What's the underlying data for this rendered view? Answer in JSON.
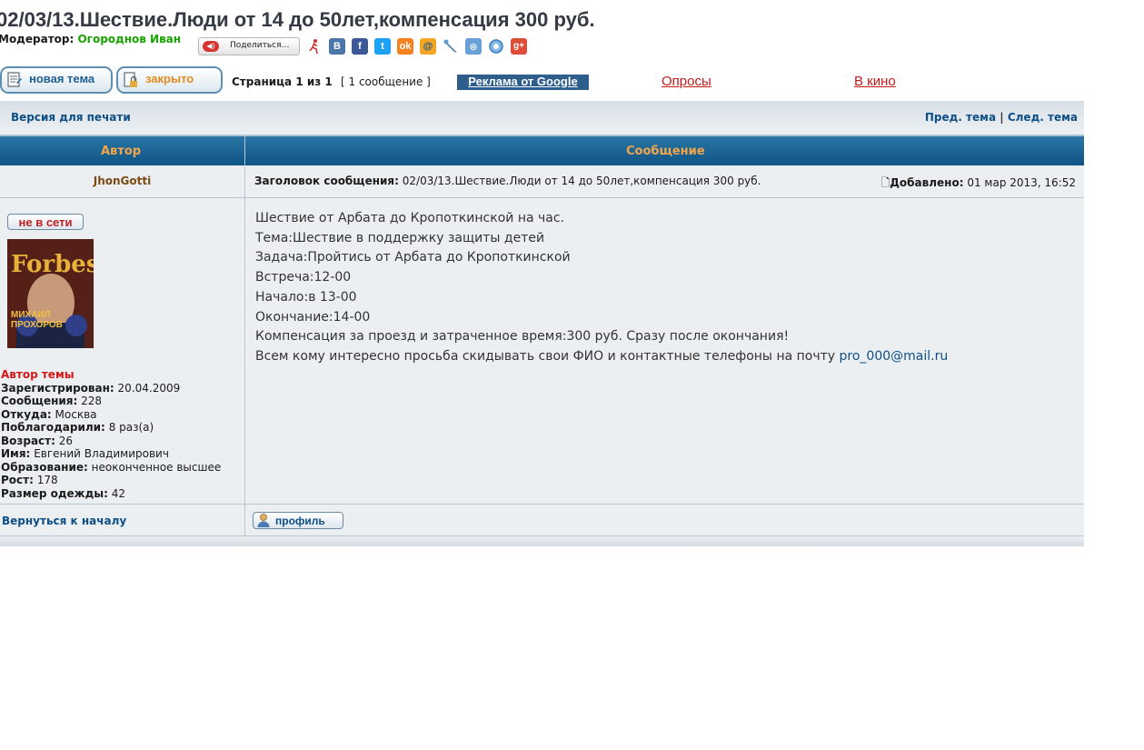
{
  "topic": {
    "title": "02/03/13.Шествие.Люди от 14 до 50лет,компенсация 300 руб.",
    "moderator_label": "Модератор:",
    "moderator_name": "Огороднов Иван",
    "share_label": "Поделиться…"
  },
  "social_icons": [
    "vk-icon",
    "facebook-icon",
    "twitter-icon",
    "odnoklassniki-icon",
    "mailru-icon",
    "livejournal-icon",
    "myworld-icon",
    "liveinternet-icon",
    "google-plus-icon"
  ],
  "toolbar": {
    "new_topic": "новая тема",
    "closed": "закрыто",
    "page_info": "Страница 1 из 1",
    "msg_count": "[ 1 сообщение ]",
    "ad_google": "Реклама от Google",
    "polls": "Опросы",
    "movies": "В кино"
  },
  "nav": {
    "print_version": "Версия для печати",
    "prev_topic": "Пред. тема",
    "separator": "|",
    "next_topic": "След. тема"
  },
  "table": {
    "col_author": "Автор",
    "col_message": "Сообщение"
  },
  "post": {
    "author": "JhonGotti",
    "subject_label": "Заголовок сообщения:",
    "subject": "02/03/13.Шествие.Люди от 14 до 50лет,компенсация 300 руб.",
    "added_label": "Добавлено:",
    "added_date": "01 мар 2013, 16:52",
    "status": "не в сети",
    "body_lines": [
      "Шествие от Арбата до Кропоткинской на час.",
      "Тема:Шествие в поддержку защиты детей",
      "Задача:Пройтись от Арбата до Кропоткинской",
      "Встреча:12-00",
      "Начало:в 13-00",
      "Окончание:14-00",
      "Компенсация за проезд и затраченное время:300 руб. Сразу после окончания!"
    ],
    "last_line_text": "Всем кому интересно просьба скидывать свои ФИО и контактные телефоны на почту",
    "email": "pro_000@mail.ru"
  },
  "profile": {
    "topic_author": "Автор темы",
    "registered_label": "Зарегистрирован:",
    "registered": "20.04.2009",
    "messages_label": "Сообщения:",
    "messages": "228",
    "from_label": "Откуда:",
    "from": "Москва",
    "thanked_label": "Поблагодарили:",
    "thanked": "8 раз(а)",
    "age_label": "Возраст:",
    "age": "26",
    "name_label": "Имя:",
    "name": "Евгений Владимирович",
    "education_label": "Образование:",
    "education": "неоконченное высшее",
    "height_label": "Рост:",
    "height": "178",
    "size_label": "Размер одежды:",
    "size": "42"
  },
  "footer": {
    "back_to_top": "Вернуться к началу",
    "profile_button": "профиль"
  },
  "avatar_text": {
    "brand": "Forbes",
    "name1": "МИХАИЛ",
    "name2": "ПРОХОРОВ"
  },
  "colors": {
    "header_bar": "#1a629a",
    "header_text": "#f3a64a",
    "link": "#0d4f86",
    "moderator": "#17a300",
    "red_link": "#c51a1a"
  }
}
